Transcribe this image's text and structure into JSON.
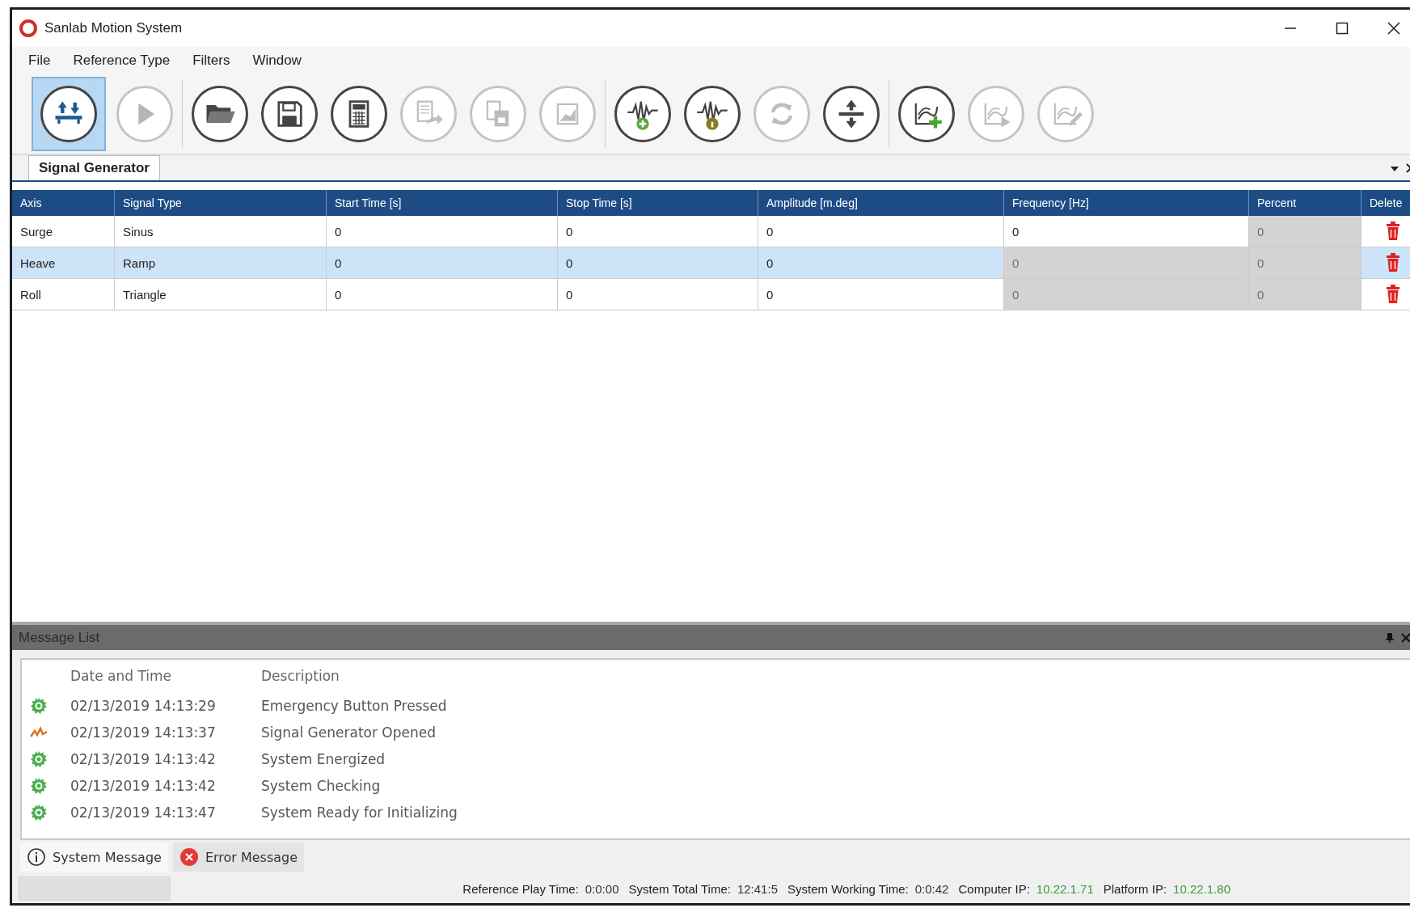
{
  "window": {
    "title": "Sanlab Motion System"
  },
  "menu": [
    "File",
    "Reference Type",
    "Filters",
    "Window"
  ],
  "toolbar": {
    "groups": [
      [
        {
          "kind": "platform",
          "selected": true,
          "disabled": false
        },
        {
          "kind": "play",
          "selected": false,
          "disabled": true
        }
      ],
      [
        {
          "kind": "open",
          "selected": false,
          "disabled": false
        },
        {
          "kind": "save",
          "selected": false,
          "disabled": false
        },
        {
          "kind": "calculator",
          "selected": false,
          "disabled": false
        },
        {
          "kind": "export",
          "selected": false,
          "disabled": true
        },
        {
          "kind": "copy",
          "selected": false,
          "disabled": true
        },
        {
          "kind": "chart",
          "selected": false,
          "disabled": true
        }
      ],
      [
        {
          "kind": "wave-add",
          "selected": false,
          "disabled": false
        },
        {
          "kind": "wave-info",
          "selected": false,
          "disabled": false
        },
        {
          "kind": "refresh",
          "selected": false,
          "disabled": true
        },
        {
          "kind": "lift",
          "selected": false,
          "disabled": false
        }
      ],
      [
        {
          "kind": "graph-add",
          "selected": false,
          "disabled": false
        },
        {
          "kind": "graph-play",
          "selected": false,
          "disabled": true
        },
        {
          "kind": "graph-edit",
          "selected": false,
          "disabled": true
        }
      ]
    ]
  },
  "document_tab": {
    "label": "Signal Generator"
  },
  "table": {
    "columns": [
      "Axis",
      "Signal Type",
      "Start Time [s]",
      "Stop Time [s]",
      "Amplitude [m.deg]",
      "Frequency [Hz]",
      "Percent",
      "Delete"
    ],
    "rows": [
      {
        "selected": false,
        "cells": [
          {
            "text": "Surge",
            "disabled": false
          },
          {
            "text": "Sinus",
            "disabled": false
          },
          {
            "text": "0",
            "disabled": false
          },
          {
            "text": "0",
            "disabled": false
          },
          {
            "text": "0",
            "disabled": false
          },
          {
            "text": "0",
            "disabled": false
          },
          {
            "text": "0",
            "disabled": true
          }
        ]
      },
      {
        "selected": true,
        "cells": [
          {
            "text": "Heave",
            "disabled": false
          },
          {
            "text": "Ramp",
            "disabled": false
          },
          {
            "text": "0",
            "disabled": false
          },
          {
            "text": "0",
            "disabled": false
          },
          {
            "text": "0",
            "disabled": false
          },
          {
            "text": "0",
            "disabled": true
          },
          {
            "text": "0",
            "disabled": true
          }
        ]
      },
      {
        "selected": false,
        "cells": [
          {
            "text": "Roll",
            "disabled": false
          },
          {
            "text": "Triangle",
            "disabled": false
          },
          {
            "text": "0",
            "disabled": false
          },
          {
            "text": "0",
            "disabled": false
          },
          {
            "text": "0",
            "disabled": false
          },
          {
            "text": "0",
            "disabled": true
          },
          {
            "text": "0",
            "disabled": true
          }
        ]
      }
    ]
  },
  "message_panel": {
    "title": "Message List",
    "columns": [
      "Date and Time",
      "Description"
    ],
    "messages": [
      {
        "kind": "system",
        "time": "02/13/2019 14:13:29",
        "description": "Emergency Button Pressed"
      },
      {
        "kind": "signal",
        "time": "02/13/2019 14:13:37",
        "description": "Signal Generator Opened"
      },
      {
        "kind": "system",
        "time": "02/13/2019 14:13:42",
        "description": "System Energized"
      },
      {
        "kind": "system",
        "time": "02/13/2019 14:13:42",
        "description": "System Checking"
      },
      {
        "kind": "system",
        "time": "02/13/2019 14:13:47",
        "description": "System Ready for Initializing"
      }
    ],
    "tabs": [
      {
        "kind": "info",
        "label": "System Message",
        "selected": true
      },
      {
        "kind": "error",
        "label": "Error Message",
        "selected": false
      }
    ]
  },
  "status_bar": [
    {
      "label": "Reference Play Time:",
      "value": "0:0:00",
      "color": "#333333"
    },
    {
      "label": "System Total Time:",
      "value": "12:41:5",
      "color": "#333333"
    },
    {
      "label": "System Working Time:",
      "value": "0:0:42",
      "color": "#333333"
    },
    {
      "label": "Computer IP:",
      "value": "10.22.1.71",
      "color": "#3a9a3a"
    },
    {
      "label": "Platform IP:",
      "value": "10.22.1.80",
      "color": "#3a9a3a"
    }
  ]
}
